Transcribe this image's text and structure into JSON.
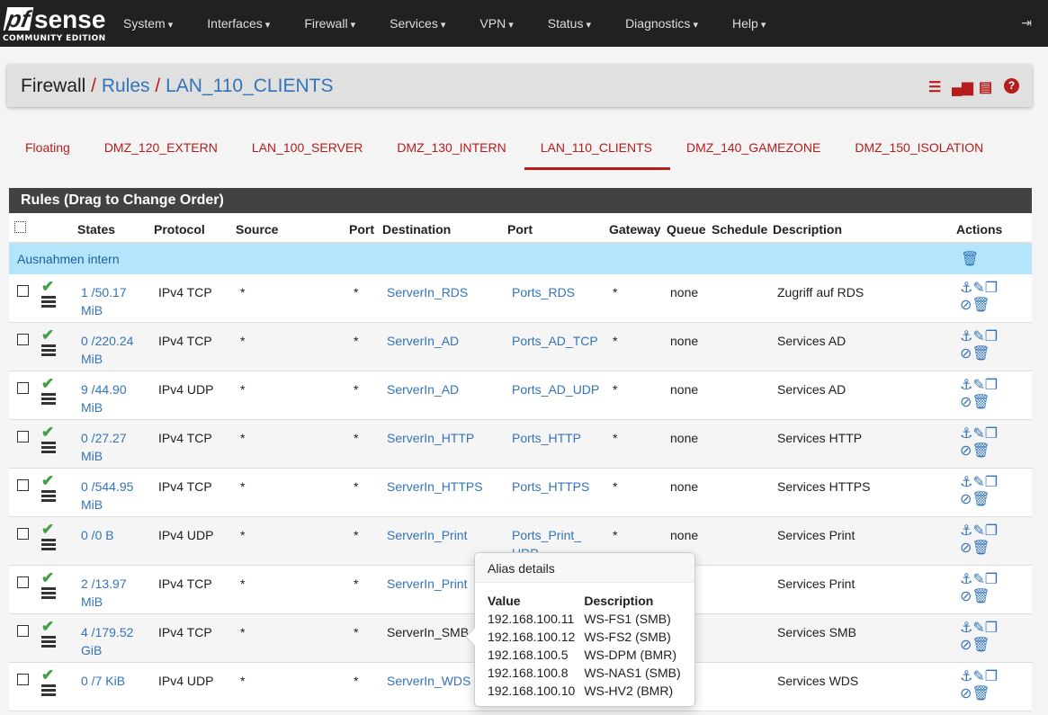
{
  "nav": {
    "logo": "pfsense",
    "logo_sub": "COMMUNITY EDITION",
    "menu": [
      "System",
      "Interfaces",
      "Firewall",
      "Services",
      "VPN",
      "Status",
      "Diagnostics",
      "Help"
    ]
  },
  "breadcrumb": {
    "root": "Firewall",
    "rules": "Rules",
    "current": "LAN_110_CLIENTS"
  },
  "tabs": [
    {
      "label": "Floating"
    },
    {
      "label": "DMZ_120_EXTERN"
    },
    {
      "label": "LAN_100_SERVER"
    },
    {
      "label": "DMZ_130_INTERN"
    },
    {
      "label": "LAN_110_CLIENTS",
      "active": true
    },
    {
      "label": "DMZ_140_GAMEZONE"
    },
    {
      "label": "DMZ_150_ISOLATION"
    }
  ],
  "panel": {
    "title": "Rules (Drag to Change Order)"
  },
  "headers": {
    "states": "States",
    "protocol": "Protocol",
    "source": "Source",
    "port": "Port",
    "destination": "Destination",
    "dport": "Port",
    "gateway": "Gateway",
    "queue": "Queue",
    "schedule": "Schedule",
    "description": "Description",
    "actions": "Actions"
  },
  "separator": "Ausnahmen intern",
  "rules": [
    {
      "s1": "1 /50.17",
      "s2": "MiB",
      "proto": "IPv4 TCP",
      "src": "*",
      "sport": "*",
      "dst": "ServerIn_RDS",
      "dport": "Ports_RDS",
      "gw": "*",
      "queue": "none",
      "desc": "Zugriff auf RDS"
    },
    {
      "s1": "0 /220.24",
      "s2": "MiB",
      "proto": "IPv4 TCP",
      "src": "*",
      "sport": "*",
      "dst": "ServerIn_AD",
      "dport": "Ports_AD_TCP",
      "gw": "*",
      "queue": "none",
      "desc": "Services AD"
    },
    {
      "s1": "9 /44.90",
      "s2": "MiB",
      "proto": "IPv4 UDP",
      "src": "*",
      "sport": "*",
      "dst": "ServerIn_AD",
      "dport": "Ports_AD_UDP",
      "gw": "*",
      "queue": "none",
      "desc": "Services AD"
    },
    {
      "s1": "0 /27.27",
      "s2": "MiB",
      "proto": "IPv4 TCP",
      "src": "*",
      "sport": "*",
      "dst": "ServerIn_HTTP",
      "dport": "Ports_HTTP",
      "gw": "*",
      "queue": "none",
      "desc": "Services HTTP"
    },
    {
      "s1": "0 /544.95",
      "s2": "MiB",
      "proto": "IPv4 TCP",
      "src": "*",
      "sport": "*",
      "dst": "ServerIn_HTTPS",
      "dport": "Ports_HTTPS",
      "gw": "*",
      "queue": "none",
      "desc": "Services HTTPS"
    },
    {
      "s1": "0 /0 B",
      "s2": "",
      "proto": "IPv4 UDP",
      "src": "*",
      "sport": "*",
      "dst": "ServerIn_Print",
      "dport": "Ports_Print_ UDP",
      "gw": "*",
      "queue": "none",
      "desc": "Services Print"
    },
    {
      "s1": "2 /13.97",
      "s2": "MiB",
      "proto": "IPv4 TCP",
      "src": "*",
      "sport": "*",
      "dst": "ServerIn_Print",
      "dport": "",
      "gw": "",
      "queue": "ne",
      "desc": "Services Print"
    },
    {
      "s1": "4 /179.52",
      "s2": "GiB",
      "proto": "IPv4 TCP",
      "src": "*",
      "sport": "*",
      "dst": "ServerIn_SMB",
      "dport": "",
      "gw": "",
      "queue": "ne",
      "desc": "Services SMB"
    },
    {
      "s1": "0 /7 KiB",
      "s2": "",
      "proto": "IPv4 UDP",
      "src": "*",
      "sport": "*",
      "dst": "ServerIn_WDS",
      "dport": "",
      "gw": "",
      "queue": "ne",
      "desc": "Services WDS"
    }
  ],
  "popover": {
    "title": "Alias details",
    "col_value": "Value",
    "col_desc": "Description",
    "items": [
      {
        "value": "192.168.100.11",
        "desc": "WS-FS1 (SMB)"
      },
      {
        "value": "192.168.100.12",
        "desc": "WS-FS2 (SMB)"
      },
      {
        "value": "192.168.100.5",
        "desc": "WS-DPM (BMR)"
      },
      {
        "value": "192.168.100.8",
        "desc": "WS-NAS1 (SMB)"
      },
      {
        "value": "192.168.100.10",
        "desc": "WS-HV2 (BMR)"
      }
    ]
  }
}
